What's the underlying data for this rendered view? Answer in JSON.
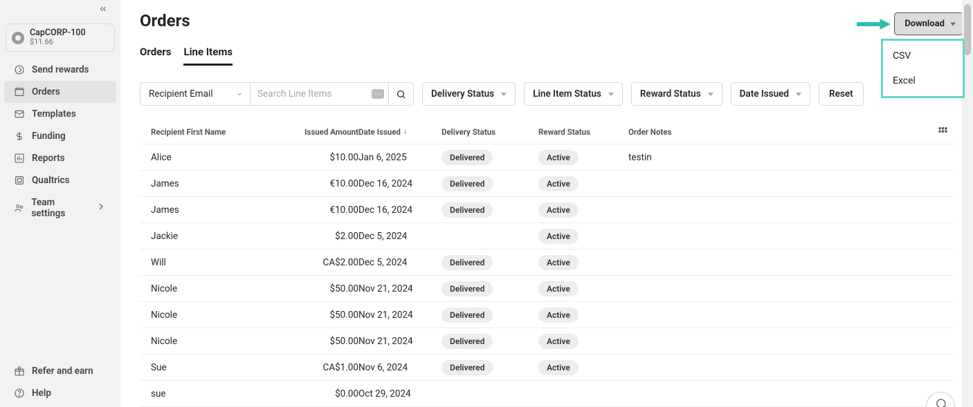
{
  "account": {
    "name": "CapCORP-100",
    "balance": "$11.66"
  },
  "sidebar": {
    "items": [
      {
        "label": "Send rewards"
      },
      {
        "label": "Orders"
      },
      {
        "label": "Templates"
      },
      {
        "label": "Funding"
      },
      {
        "label": "Reports"
      },
      {
        "label": "Qualtrics"
      },
      {
        "label": "Team settings"
      }
    ],
    "bottom": [
      {
        "label": "Refer and earn"
      },
      {
        "label": "Help"
      }
    ]
  },
  "page": {
    "title": "Orders"
  },
  "tabs": [
    {
      "label": "Orders"
    },
    {
      "label": "Line Items"
    }
  ],
  "download": {
    "button": "Download",
    "options": [
      "CSV",
      "Excel"
    ]
  },
  "filters": {
    "fieldSelect": "Recipient Email",
    "searchPlaceholder": "Search Line Items",
    "kbd": "⋯",
    "deliveryStatus": "Delivery Status",
    "lineItemStatus": "Line Item Status",
    "rewardStatus": "Reward Status",
    "dateIssued": "Date Issued",
    "reset": "Reset"
  },
  "table": {
    "columns": {
      "firstName": "Recipient First Name",
      "issuedAmount": "Issued Amount",
      "dateIssued": "Date Issued",
      "deliveryStatus": "Delivery Status",
      "rewardStatus": "Reward Status",
      "orderNotes": "Order Notes"
    },
    "rows": [
      {
        "name": "Alice",
        "amount": "$10.00",
        "date": "Jan 6, 2025",
        "delivery": "Delivered",
        "reward": "Active",
        "notes": "testin"
      },
      {
        "name": "James",
        "amount": "€10.00",
        "date": "Dec 16, 2024",
        "delivery": "Delivered",
        "reward": "Active",
        "notes": ""
      },
      {
        "name": "James",
        "amount": "€10.00",
        "date": "Dec 16, 2024",
        "delivery": "Delivered",
        "reward": "Active",
        "notes": ""
      },
      {
        "name": "Jackie",
        "amount": "$2.00",
        "date": "Dec 5, 2024",
        "delivery": "",
        "reward": "Active",
        "notes": ""
      },
      {
        "name": "Will",
        "amount": "CA$2.00",
        "date": "Dec 5, 2024",
        "delivery": "Delivered",
        "reward": "Active",
        "notes": ""
      },
      {
        "name": "Nicole",
        "amount": "$50.00",
        "date": "Nov 21, 2024",
        "delivery": "Delivered",
        "reward": "Active",
        "notes": ""
      },
      {
        "name": "Nicole",
        "amount": "$50.00",
        "date": "Nov 21, 2024",
        "delivery": "Delivered",
        "reward": "Active",
        "notes": ""
      },
      {
        "name": "Nicole",
        "amount": "$50.00",
        "date": "Nov 21, 2024",
        "delivery": "Delivered",
        "reward": "Active",
        "notes": ""
      },
      {
        "name": "Sue",
        "amount": "CA$1.00",
        "date": "Nov 6, 2024",
        "delivery": "Delivered",
        "reward": "Active",
        "notes": ""
      },
      {
        "name": "sue",
        "amount": "$0.00",
        "date": "Oct 29, 2024",
        "delivery": "",
        "reward": "",
        "notes": ""
      }
    ]
  }
}
